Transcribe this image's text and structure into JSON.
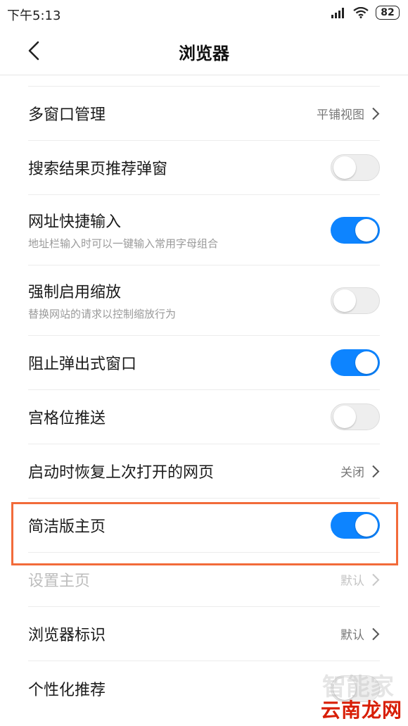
{
  "status_bar": {
    "time": "下午5:13",
    "battery": "82"
  },
  "header": {
    "title": "浏览器"
  },
  "settings": [
    {
      "label": "多窗口管理",
      "type": "link",
      "value": "平铺视图"
    },
    {
      "label": "搜索结果页推荐弹窗",
      "type": "toggle",
      "state": "off"
    },
    {
      "label": "网址快捷输入",
      "sub": "地址栏输入时可以一键输入常用字母组合",
      "type": "toggle",
      "state": "on"
    },
    {
      "label": "强制启用缩放",
      "sub": "替换网站的请求以控制缩放行为",
      "type": "toggle",
      "state": "off"
    },
    {
      "label": "阻止弹出式窗口",
      "type": "toggle",
      "state": "on"
    },
    {
      "label": "宫格位推送",
      "type": "toggle",
      "state": "off"
    },
    {
      "label": "启动时恢复上次打开的网页",
      "type": "link",
      "value": "关闭"
    },
    {
      "label": "简洁版主页",
      "type": "toggle",
      "state": "on",
      "highlighted": true
    },
    {
      "label": "设置主页",
      "type": "link",
      "value": "默认",
      "disabled": true
    },
    {
      "label": "浏览器标识",
      "type": "link",
      "value": "默认"
    },
    {
      "label": "个性化推荐",
      "type": "toggle",
      "state": "off"
    }
  ],
  "watermark": {
    "main": "云南龙网",
    "faint": "智能家"
  },
  "colors": {
    "accent": "#0d84ff",
    "highlight": "#f26b3a"
  }
}
